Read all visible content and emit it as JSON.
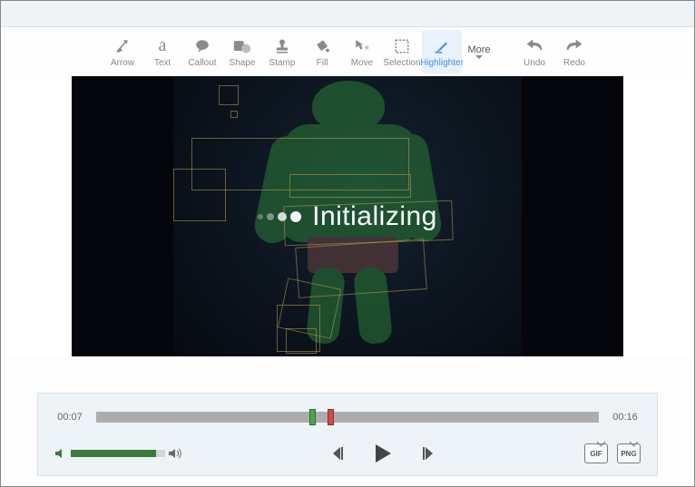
{
  "toolbar": {
    "tools": [
      {
        "label": "Arrow",
        "icon": "arrow"
      },
      {
        "label": "Text",
        "icon": "text"
      },
      {
        "label": "Callout",
        "icon": "callout"
      },
      {
        "label": "Shape",
        "icon": "shape"
      },
      {
        "label": "Stamp",
        "icon": "stamp"
      },
      {
        "label": "Fill",
        "icon": "fill"
      },
      {
        "label": "Move",
        "icon": "move"
      },
      {
        "label": "Selection",
        "icon": "selection"
      },
      {
        "label": "Highlighter",
        "icon": "highlighter",
        "selected": true
      }
    ],
    "more_label": "More",
    "history": [
      {
        "label": "Undo",
        "icon": "undo"
      },
      {
        "label": "Redo",
        "icon": "redo"
      }
    ]
  },
  "video": {
    "status_text": "Initializing"
  },
  "controls": {
    "current_time": "00:07",
    "total_time": "00:16",
    "trim_start_pct": 42.4,
    "trim_end_pct": 46,
    "volume_pct": 90,
    "exports": [
      {
        "label": "GIF"
      },
      {
        "label": "PNG"
      }
    ]
  }
}
